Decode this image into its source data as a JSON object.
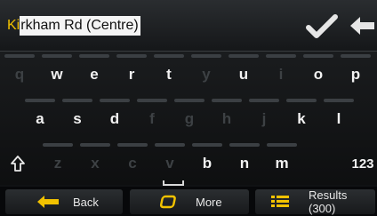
{
  "input": {
    "typed": "Ki",
    "suggestion": "rkham Rd (Centre)"
  },
  "header": {
    "confirm_icon": "checkmark-icon",
    "backspace_icon": "backspace-arrow-icon"
  },
  "keyboard": {
    "row1": [
      {
        "label": "q",
        "enabled": false
      },
      {
        "label": "w",
        "enabled": true
      },
      {
        "label": "e",
        "enabled": true
      },
      {
        "label": "r",
        "enabled": true
      },
      {
        "label": "t",
        "enabled": true
      },
      {
        "label": "y",
        "enabled": false
      },
      {
        "label": "u",
        "enabled": true
      },
      {
        "label": "i",
        "enabled": false
      },
      {
        "label": "o",
        "enabled": true
      },
      {
        "label": "p",
        "enabled": true
      }
    ],
    "row2": [
      {
        "label": "a",
        "enabled": true
      },
      {
        "label": "s",
        "enabled": true
      },
      {
        "label": "d",
        "enabled": true
      },
      {
        "label": "f",
        "enabled": false
      },
      {
        "label": "g",
        "enabled": false
      },
      {
        "label": "h",
        "enabled": false
      },
      {
        "label": "j",
        "enabled": false
      },
      {
        "label": "k",
        "enabled": true
      },
      {
        "label": "l",
        "enabled": true
      }
    ],
    "row3": [
      {
        "label": "z",
        "enabled": false
      },
      {
        "label": "x",
        "enabled": false
      },
      {
        "label": "c",
        "enabled": false
      },
      {
        "label": "v",
        "enabled": false
      },
      {
        "label": "b",
        "enabled": true
      },
      {
        "label": "n",
        "enabled": true
      },
      {
        "label": "m",
        "enabled": true
      }
    ],
    "shift_icon": "shift-arrow-icon",
    "numbers_label": "123",
    "space_icon": "spacebar-icon"
  },
  "bottom": {
    "back_label": "Back",
    "more_label": "More",
    "results_label": "Results (300)"
  },
  "colors": {
    "typed_text": "#f2c200",
    "icon_yellow": "#f2c200",
    "key_text": "#f2f2f2",
    "key_disabled": "#3d4144"
  }
}
